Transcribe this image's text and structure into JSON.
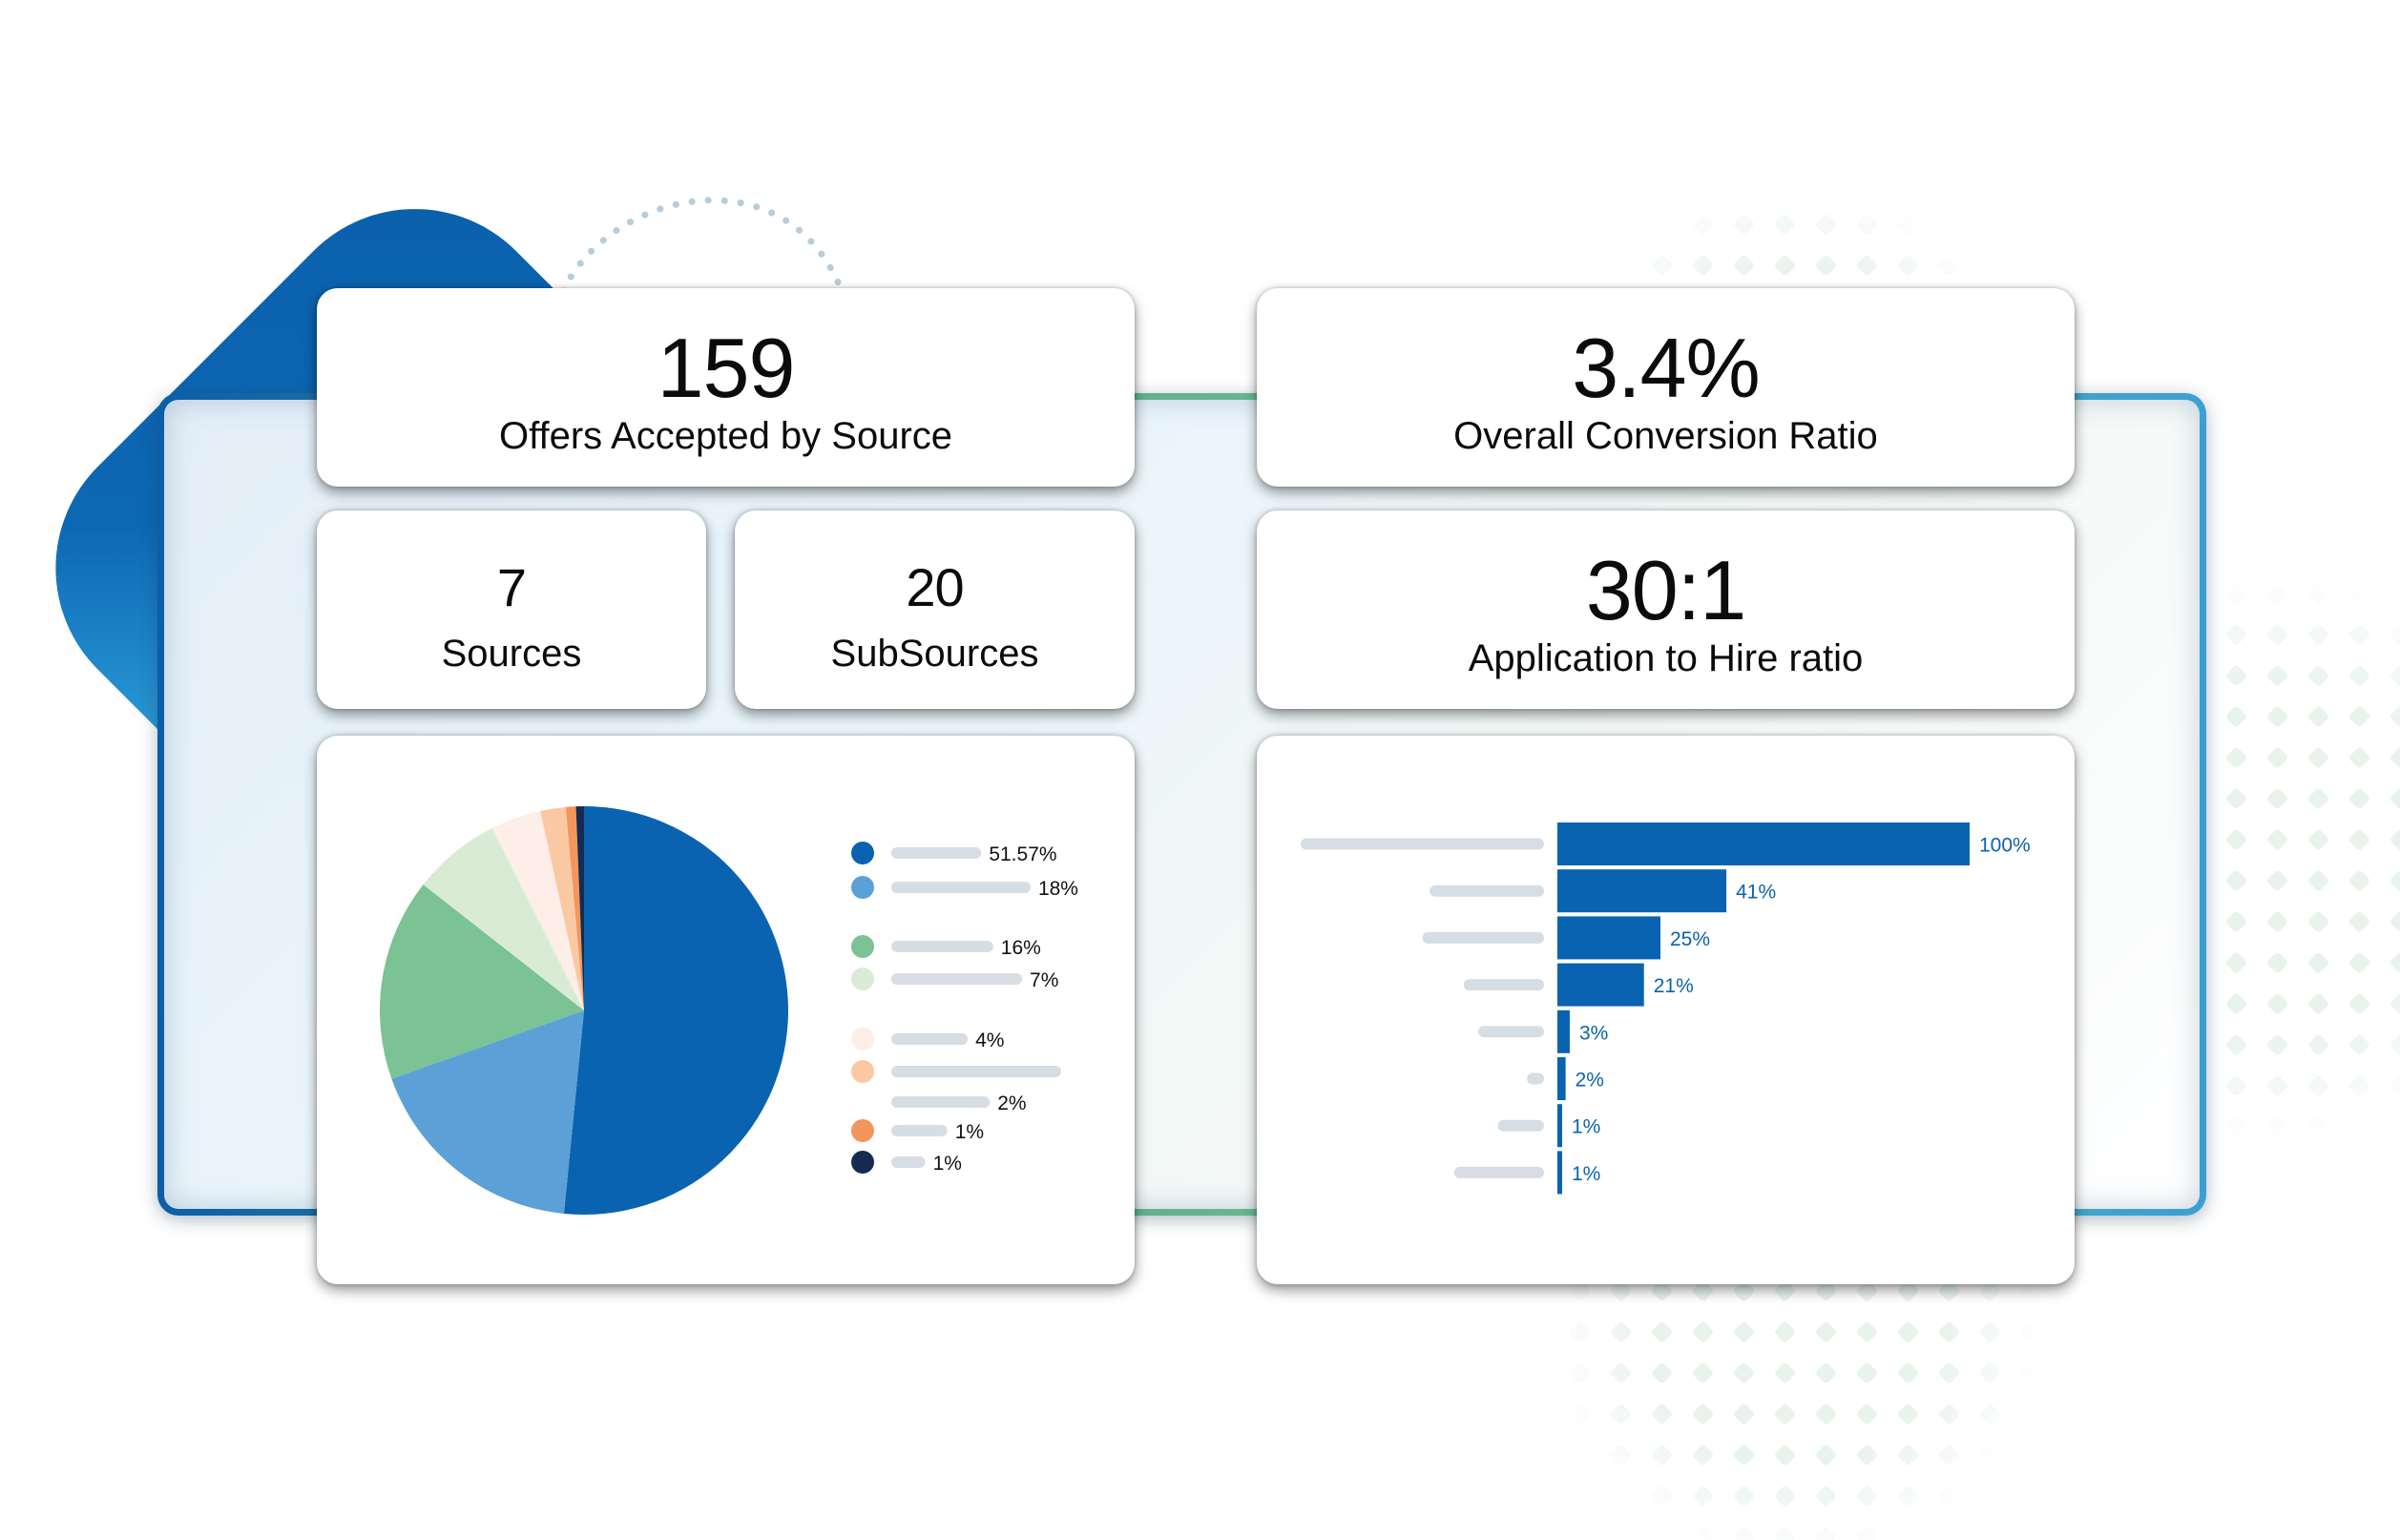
{
  "colors": {
    "primary_blue": "#0a63b0",
    "placeholder_gray": "#d7dde5",
    "card_bg": "#ffffff",
    "text_dark": "#0b0b0b"
  },
  "kpis": {
    "offers": {
      "value": "159",
      "label": "Offers Accepted by Source"
    },
    "sources": {
      "value": "7",
      "label": "Sources"
    },
    "subsources": {
      "value": "20",
      "label": "SubSources"
    },
    "conversion": {
      "value": "3.4%",
      "label": "Overall Conversion Ratio"
    },
    "hire_ratio": {
      "value": "30:1",
      "label": "Application to Hire ratio"
    }
  },
  "chart_data": [
    {
      "type": "pie",
      "title": "",
      "slices": [
        {
          "label": "51.57%",
          "value": 51.57,
          "color": "#0a63b0",
          "legend_bar_fraction": 0.53
        },
        {
          "label": "18%",
          "value": 18,
          "color": "#5ba1d7",
          "legend_bar_fraction": 0.82
        },
        {
          "label": "16%",
          "value": 16,
          "color": "#7bc294",
          "legend_bar_fraction": 0.6
        },
        {
          "label": "7%",
          "value": 7,
          "color": "#d9ebd4",
          "legend_bar_fraction": 0.77
        },
        {
          "label": "4%",
          "value": 4,
          "color": "#fdeee7",
          "legend_bar_fraction": 0.45
        },
        {
          "label": "2%",
          "value": 2,
          "color": "#fbc8a4",
          "legend_bar_fraction": 1.0,
          "extra_bar_fraction": 0.58
        },
        {
          "label": "1%",
          "value": 0.8,
          "color": "#f2965c",
          "legend_bar_fraction": 0.33
        },
        {
          "label": "1%",
          "value": 0.63,
          "color": "#152b52",
          "legend_bar_fraction": 0.2
        }
      ],
      "legend_placement": "right",
      "start_angle": "top",
      "direction": "clockwise"
    },
    {
      "type": "bar",
      "orientation": "horizontal",
      "title": "",
      "categories_placeholder_fractions": [
        1.0,
        0.47,
        0.5,
        0.33,
        0.27,
        0.07,
        0.19,
        0.37
      ],
      "values": [
        100,
        41,
        25,
        21,
        3,
        2,
        1,
        1
      ],
      "labels": [
        "100%",
        "41%",
        "25%",
        "21%",
        "3%",
        "2%",
        "1%",
        "1%"
      ],
      "xlim": [
        0,
        100
      ],
      "color": "#0a63b0",
      "grid": false
    }
  ]
}
